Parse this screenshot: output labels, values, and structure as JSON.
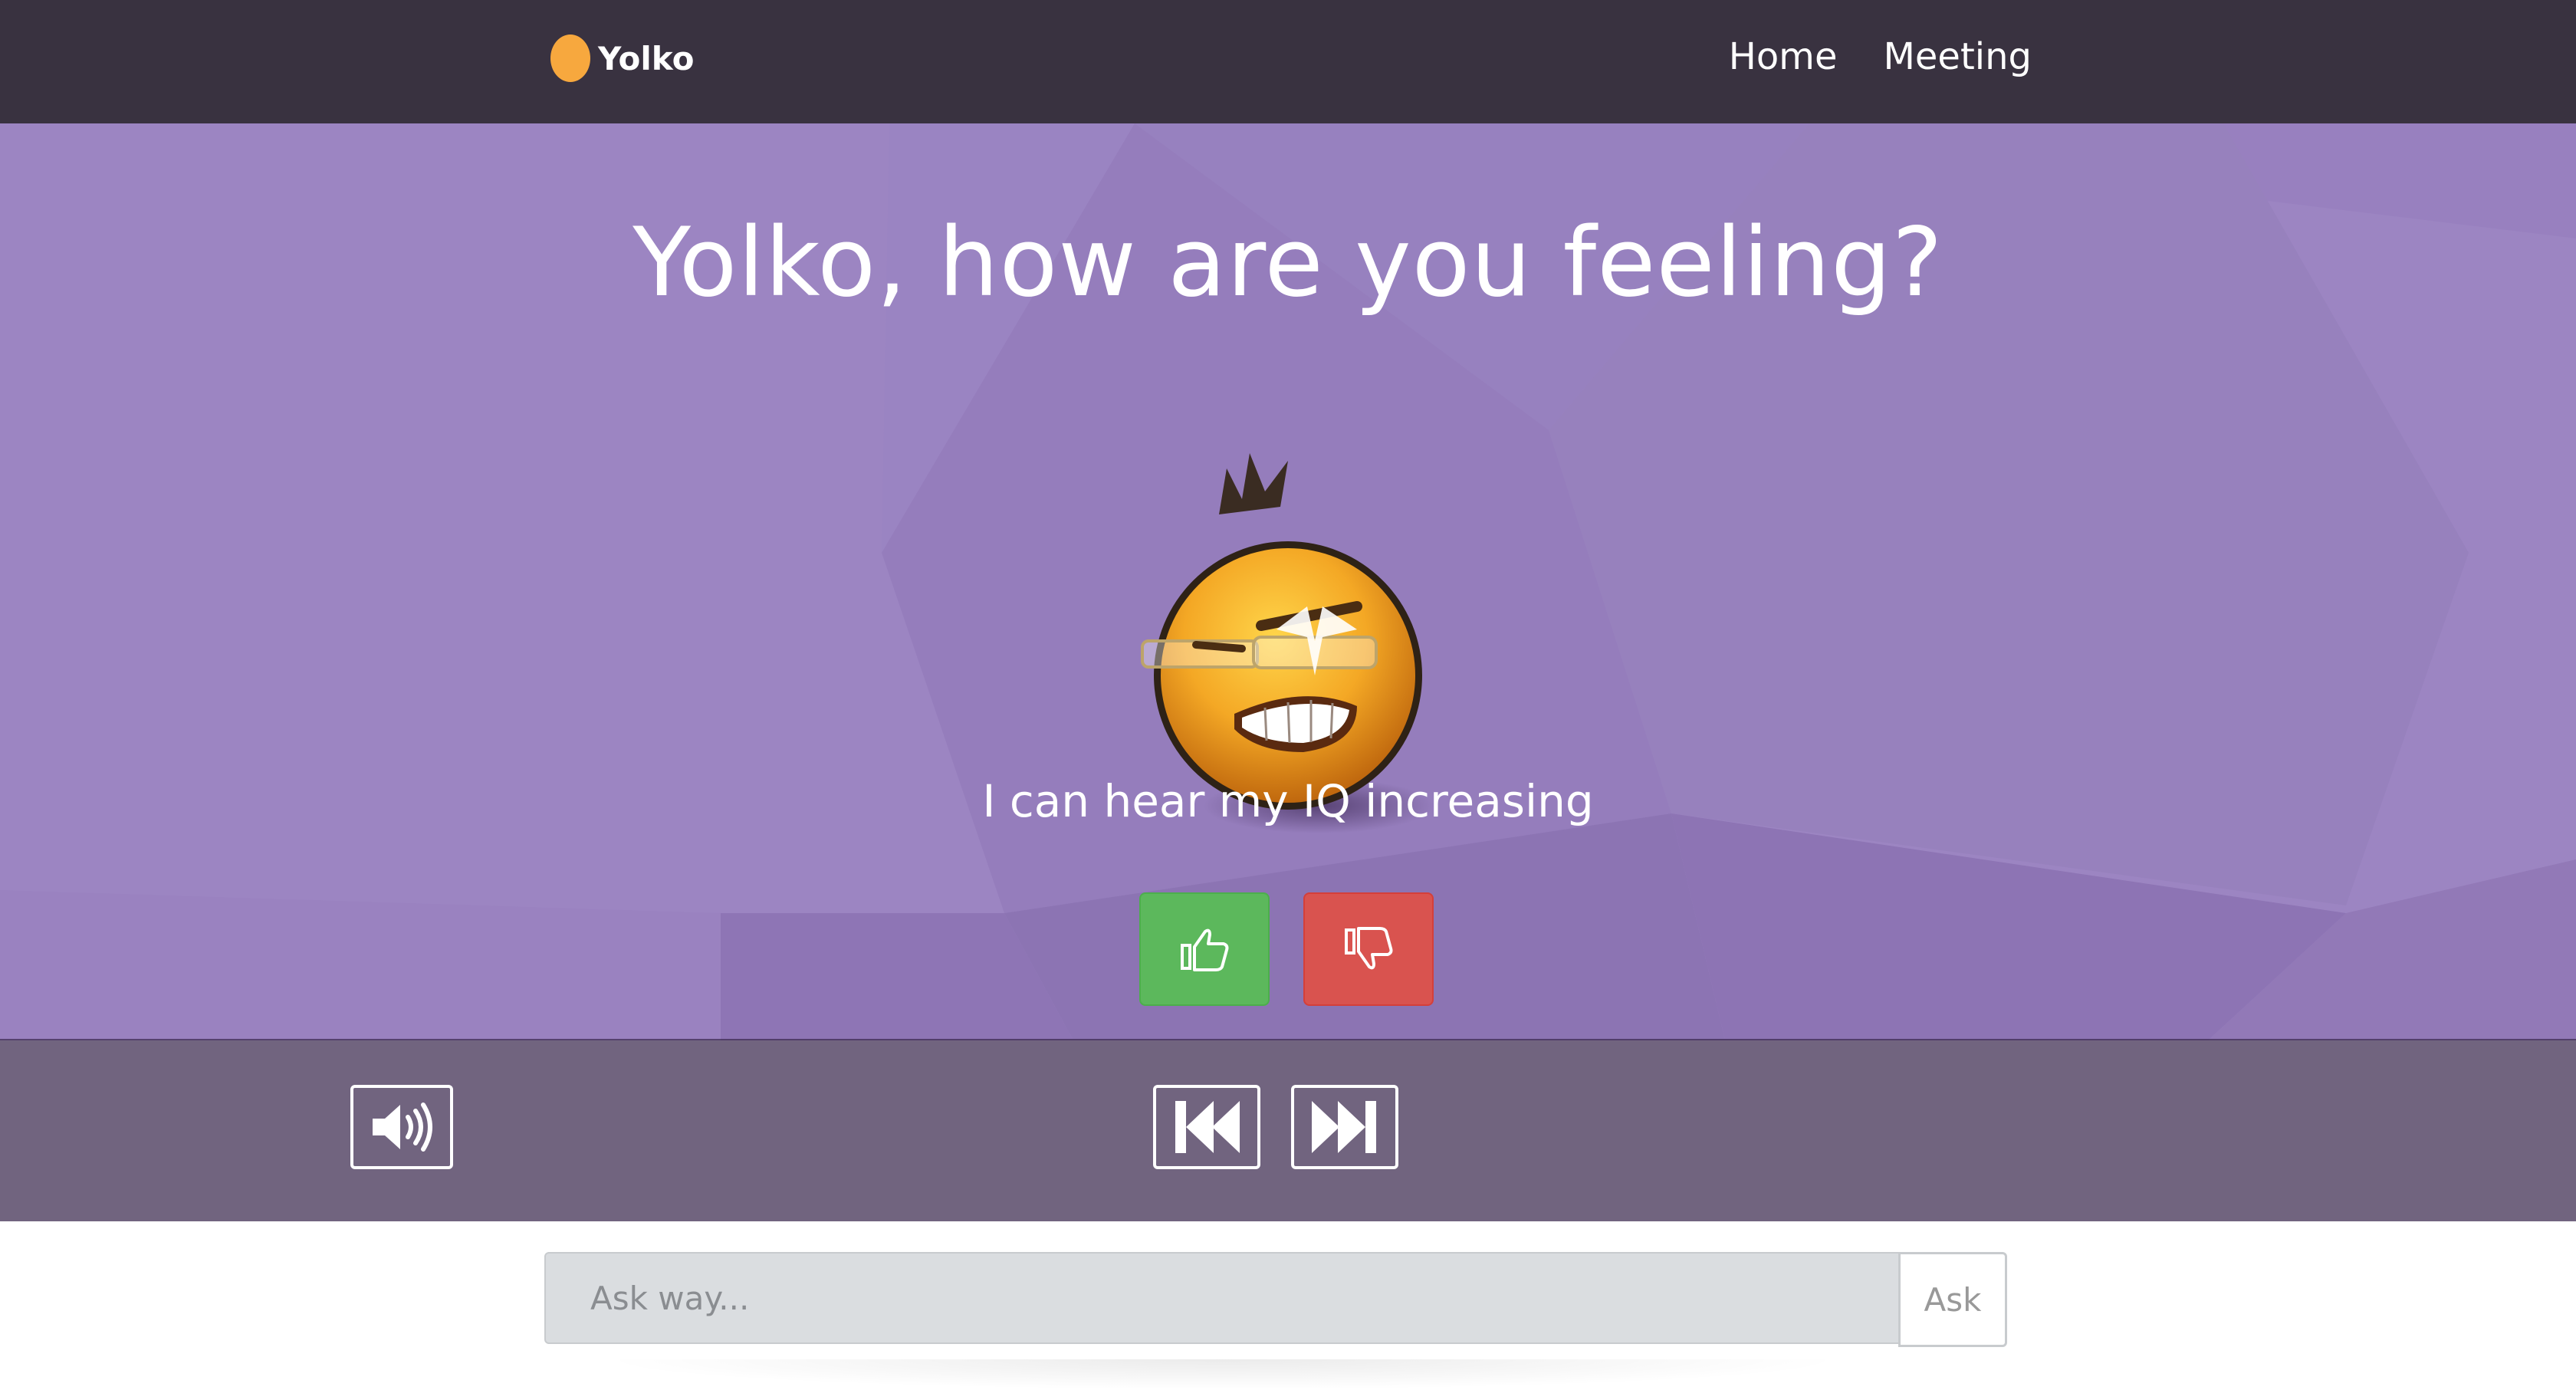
{
  "brand": {
    "name": "Yolko",
    "color": "#f7a83e"
  },
  "nav": {
    "items": [
      {
        "label": "Home"
      },
      {
        "label": "Meeting"
      }
    ]
  },
  "hero": {
    "headline": "Yolko, how are you feeling?",
    "caption": "I can hear my IQ increasing",
    "emoji": "grinning-glasses-emoji"
  },
  "vote": {
    "up_icon": "thumbs-up-icon",
    "down_icon": "thumbs-down-icon",
    "up_color": "#5cb85c",
    "down_color": "#d9534f"
  },
  "controls": {
    "speaker_icon": "speaker-volume-icon",
    "prev_icon": "skip-previous-icon",
    "next_icon": "skip-next-icon"
  },
  "ask": {
    "placeholder": "Ask way...",
    "button_label": "Ask"
  },
  "colors": {
    "navbar": "#393240",
    "hero": "#9c85c2",
    "controls_bar": "#4a3d5e"
  }
}
